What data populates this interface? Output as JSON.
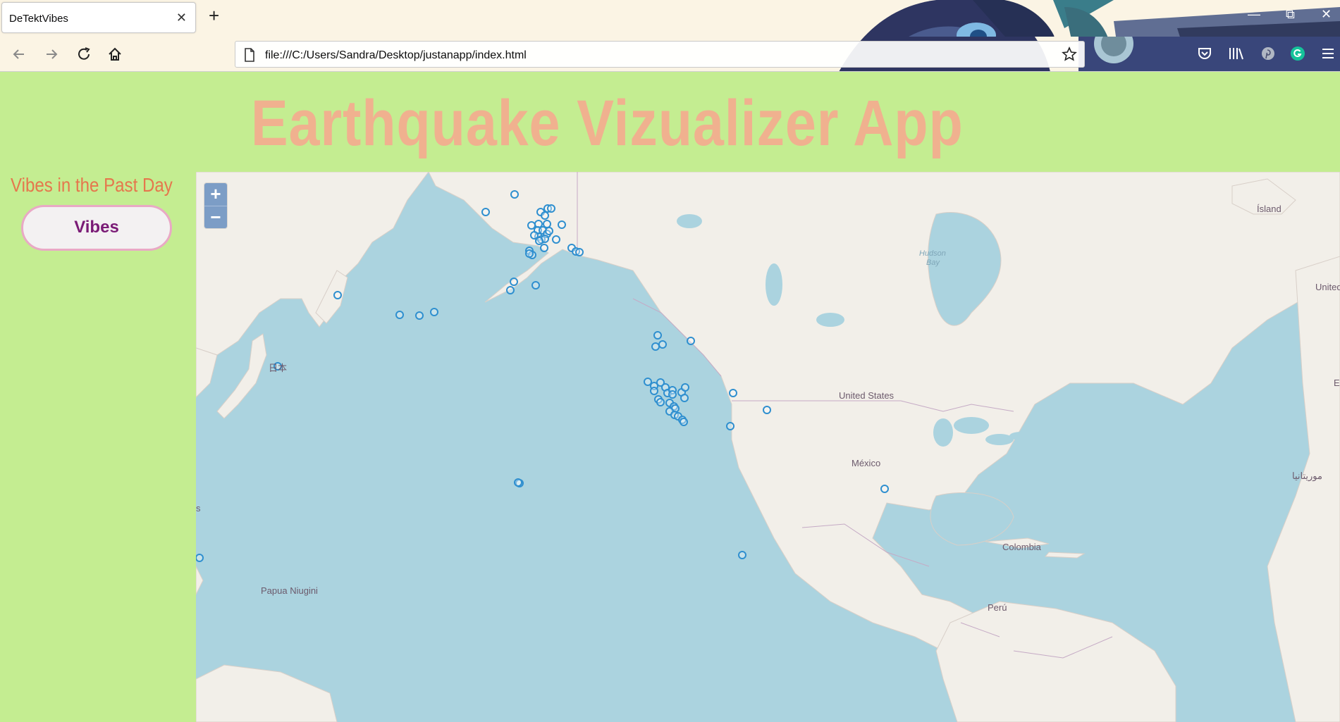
{
  "browser": {
    "tab_title": "DeTektVibes",
    "tab_close": "✕",
    "new_tab": "+",
    "url": "file:///C:/Users/Sandra/Desktop/justanapp/index.html",
    "window_controls": {
      "minimize": "—",
      "restore": "⧉",
      "close": "✕"
    },
    "nav_icons": [
      "back-arrow-icon",
      "forward-arrow-icon",
      "reload-icon",
      "home-icon"
    ],
    "toolbar_icons": [
      "pocket-icon",
      "library-icon",
      "pinterest-icon",
      "grammarly-icon",
      "menu-icon"
    ]
  },
  "page": {
    "title": "Earthquake Vizualizer App",
    "sidebar_heading": "Vibes in the Past Day",
    "vibes_button": "Vibes"
  },
  "map": {
    "zoom_in": "+",
    "zoom_out": "−",
    "labels": {
      "island": "Ísland",
      "hudson_bay_1": "Hudson",
      "hudson_bay_2": "Bay",
      "united_kingdom": "United",
      "japan": "日本",
      "united_states": "United States",
      "mexico": "México",
      "colombia": "Colombia",
      "peru": "Perú",
      "papua": "Papua Niugini",
      "morocco": "موريتانيا",
      "edge_s": "s",
      "edge_e": "E"
    },
    "marker_color": "#2f8fcf"
  }
}
